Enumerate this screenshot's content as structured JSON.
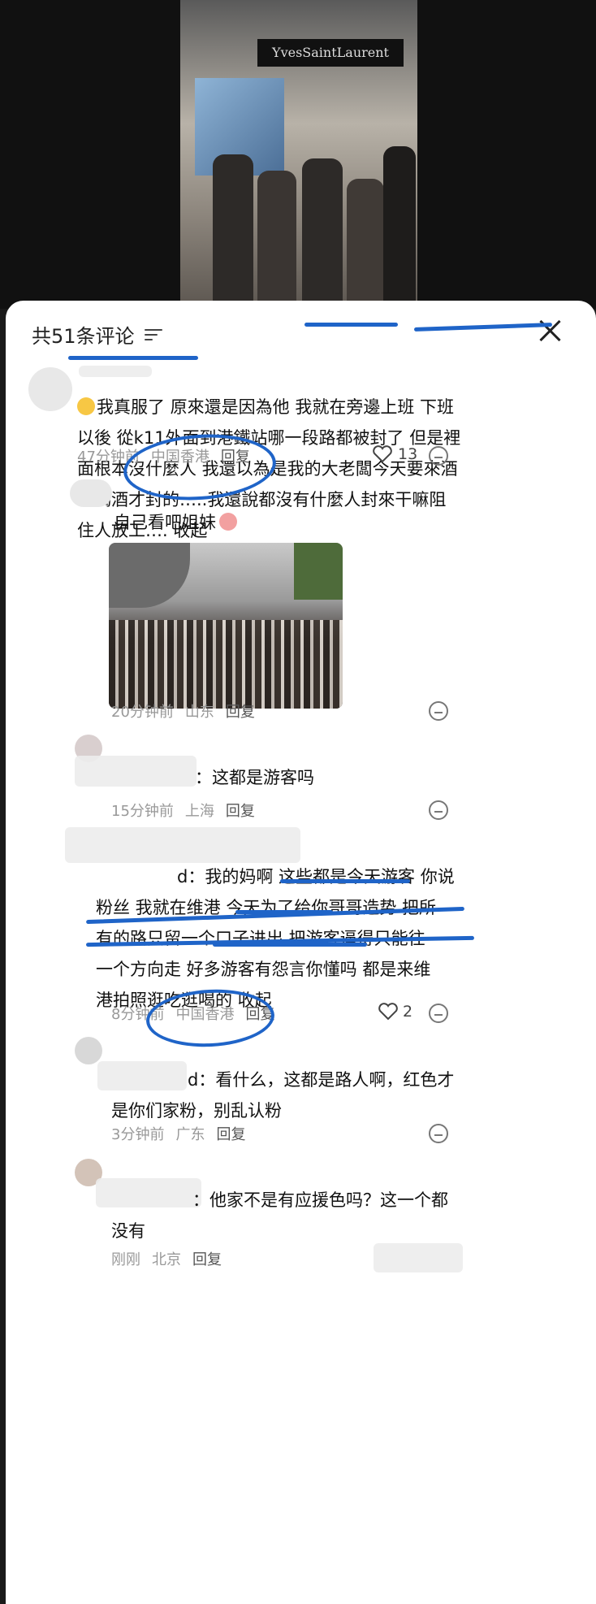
{
  "header": {
    "title": "共51条评论"
  },
  "comments": [
    {
      "text_lines": [
        "我真服了 原來還是因為他 我就在旁邊上班 下班",
        "以後 從k11外面到港鐵站哪一段路都被封了 但是裡",
        "面根本沒什麼人 我還以為是我的大老闆今天要來酒",
        "吧喝酒才封的…..我還說都沒有什麼人封來干嘛阻",
        "住人放工…. 收起"
      ],
      "time": "47分钟前",
      "location": "中国香港",
      "reply_label": "回复",
      "likes": "13"
    },
    {
      "text": "自己看吧姐妹",
      "time": "20分钟前",
      "location": "山东",
      "reply_label": "回复"
    },
    {
      "prefix": "：",
      "text": "这都是游客吗",
      "time": "15分钟前",
      "location": "上海",
      "reply_label": "回复"
    },
    {
      "prefix": "d：",
      "text_lines": [
        "我的妈啊 这些都是今天游客 你说",
        "粉丝 我就在维港 今天为了给你哥哥造势 把所",
        "有的路只留一个口子进出 把游客逼得只能往",
        "一个方向走 好多游客有怨言你懂吗 都是来维",
        "港拍照逛吃逛喝的 收起"
      ],
      "time": "8分钟前",
      "location": "中国香港",
      "reply_label": "回复",
      "likes": "2"
    },
    {
      "prefix": "d：",
      "text_lines": [
        "看什么，这都是路人啊，红色才",
        "是你们家粉，别乱认粉"
      ],
      "time": "3分钟前",
      "location": "广东",
      "reply_label": "回复"
    },
    {
      "prefix": "：",
      "text_lines": [
        "他家不是有应援色吗？这一个都",
        "没有"
      ],
      "time": "刚刚",
      "location": "北京",
      "reply_label": "回复"
    }
  ],
  "colors": {
    "annotation": "#1f64c8",
    "meta": "#999999"
  }
}
